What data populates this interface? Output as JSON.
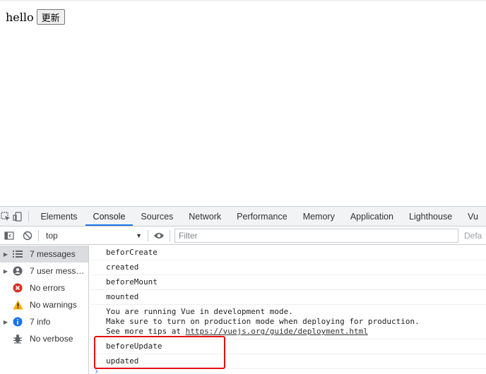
{
  "page": {
    "hello_text": "hello",
    "update_button_label": "更新"
  },
  "devtools": {
    "tabs": [
      {
        "label": "Elements"
      },
      {
        "label": "Console"
      },
      {
        "label": "Sources"
      },
      {
        "label": "Network"
      },
      {
        "label": "Performance"
      },
      {
        "label": "Memory"
      },
      {
        "label": "Application"
      },
      {
        "label": "Lighthouse"
      },
      {
        "label": "Vu"
      }
    ],
    "active_tab": "Console",
    "toolbar": {
      "context": "top",
      "filter_placeholder": "Filter",
      "levels_label": "Defa"
    },
    "sidebar": {
      "items": [
        {
          "label": "7 messages",
          "icon": "list-icon"
        },
        {
          "label": "7 user mess…",
          "icon": "user-icon"
        },
        {
          "label": "No errors",
          "icon": "error-icon"
        },
        {
          "label": "No warnings",
          "icon": "warning-icon"
        },
        {
          "label": "7 info",
          "icon": "info-icon"
        },
        {
          "label": "No verbose",
          "icon": "bug-icon"
        }
      ]
    },
    "messages": [
      {
        "text": "beforCreate"
      },
      {
        "text": "created"
      },
      {
        "text": "beforeMount"
      },
      {
        "text": "mounted"
      },
      {
        "line1": "You are running Vue in development mode.",
        "line2": "Make sure to turn on production mode when deploying for production.",
        "line3_prefix": "See more tips at ",
        "link": "https://vuejs.org/guide/deployment.html"
      },
      {
        "text": "beforeUpdate"
      },
      {
        "text": "updated"
      }
    ],
    "prompt": "›"
  },
  "colors": {
    "accent": "#1a73e8",
    "highlight_box": "#e01010",
    "error": "#d93025",
    "warning": "#f9ab00"
  }
}
